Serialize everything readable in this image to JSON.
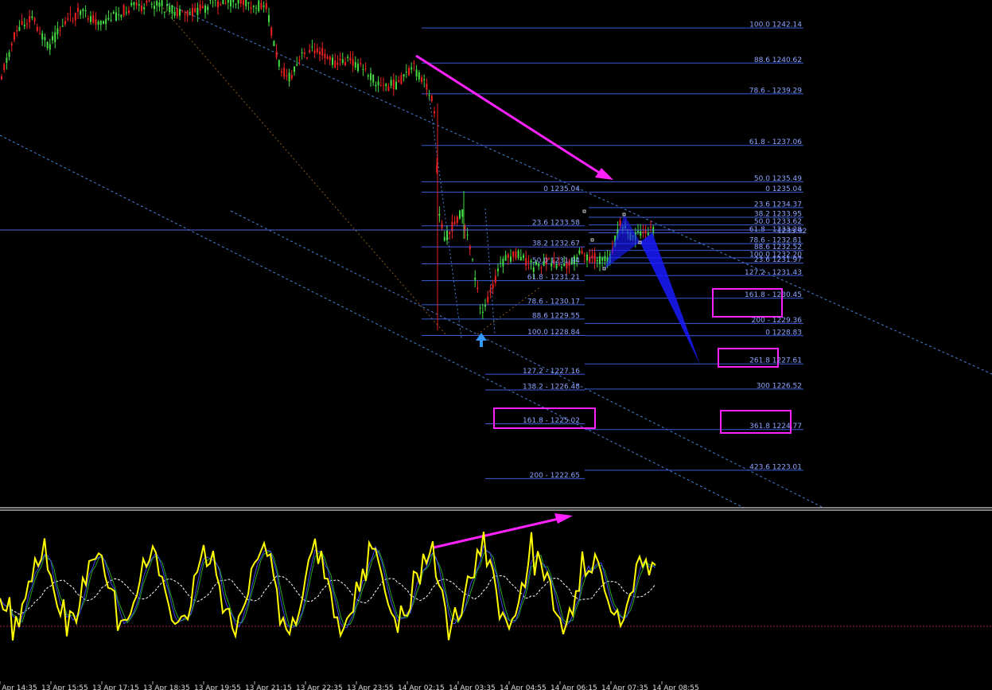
{
  "chart_data": [
    {
      "type": "candlestick",
      "panel": "price",
      "current_price": "1233.92",
      "fib_left": {
        "levels": [
          {
            "label": "0 1235.04",
            "price": 1235.04
          },
          {
            "label": "23.6 1233.58",
            "price": 1233.58
          },
          {
            "label": "38.2 1232.67",
            "price": 1232.67
          },
          {
            "label": "50.0 1231.94",
            "price": 1231.94
          },
          {
            "label": "61.8 - 1231.21",
            "price": 1231.21
          },
          {
            "label": "78.6 - 1230.17",
            "price": 1230.17
          },
          {
            "label": "88.6 1229.55",
            "price": 1229.55
          },
          {
            "label": "100.0 1228.84",
            "price": 1228.84
          },
          {
            "label": "127.2 - 1227.16",
            "price": 1227.16
          },
          {
            "label": "138.2 - 1226.48",
            "price": 1226.48
          },
          {
            "label": "161.8 - 1225.02",
            "price": 1225.02
          },
          {
            "label": "200 - 1222.65",
            "price": 1222.65
          }
        ]
      },
      "fib_right": {
        "levels": [
          {
            "label": "100.0 1242.14",
            "price": 1242.14
          },
          {
            "label": "88.6 1240.62",
            "price": 1240.62
          },
          {
            "label": "78.6 - 1239.29",
            "price": 1239.29
          },
          {
            "label": "61.8 - 1237.06",
            "price": 1237.06
          },
          {
            "label": "50.0 1235.49",
            "price": 1235.49
          },
          {
            "label": "0 1235.04",
            "price": 1235.04
          },
          {
            "label": "23.6 1234.37",
            "price": 1234.37
          },
          {
            "label": "38.2 1233.95",
            "price": 1233.95
          },
          {
            "label": "50.0 1233.62",
            "price": 1233.62
          },
          {
            "label": "61.8 - 1233.28",
            "price": 1233.28
          },
          {
            "label": "78.6 - 1232.81",
            "price": 1232.81
          },
          {
            "label": "88.6 1232.52",
            "price": 1232.52
          },
          {
            "label": "100.0 1232.20",
            "price": 1232.2
          },
          {
            "label": "23.6 1231.97",
            "price": 1231.97
          },
          {
            "label": "127.2 - 1231.43",
            "price": 1231.43
          },
          {
            "label": "161.8 - 1230.45",
            "price": 1230.45
          },
          {
            "label": "200 - 1229.36",
            "price": 1229.36
          },
          {
            "label": "0 1228.83",
            "price": 1228.83
          },
          {
            "label": "261.8 1227.61",
            "price": 1227.61
          },
          {
            "label": "300 1226.52",
            "price": 1226.52
          },
          {
            "label": "361.8 1224.77",
            "price": 1224.77
          },
          {
            "label": "423.6 1223.01",
            "price": 1223.01
          }
        ]
      },
      "highlighted_levels": [
        "161.8 - 1230.45",
        "261.8 1227.61",
        "361.8 1224.77",
        "161.8 - 1225.02"
      ],
      "x_tick_labels": [
        "13 Apr 14:35",
        "13 Apr 15:55",
        "13 Apr 17:15",
        "13 Apr 18:35",
        "13 Apr 19:55",
        "13 Apr 21:15",
        "13 Apr 22:35",
        "13 Apr 23:55",
        "14 Apr 02:15",
        "14 Apr 03:35",
        "14 Apr 04:55",
        "14 Apr 06:15",
        "14 Apr 07:35",
        "14 Apr 08:55"
      ],
      "grid": false,
      "colors": {
        "background": "#000000",
        "bull_candle": "#44dd44",
        "bear_candle": "#ee2222",
        "fib_line": "#3b5bd6",
        "fib_text": "#8ea4ff",
        "current_price_line": "#5566dd",
        "annotation": "#ff22ff",
        "pattern_fill": "#1a1aff",
        "trendline": "#4a7fd4",
        "arrow_marker": "#3399ff"
      }
    },
    {
      "type": "line",
      "panel": "oscillator",
      "series": [],
      "colors": {
        "main": "#ffff00",
        "signal_1": "#4444ee",
        "signal_2": "#22aa22",
        "average": "#ffffff",
        "level_line": "#aa2266",
        "annotation": "#ff22ff"
      }
    }
  ]
}
